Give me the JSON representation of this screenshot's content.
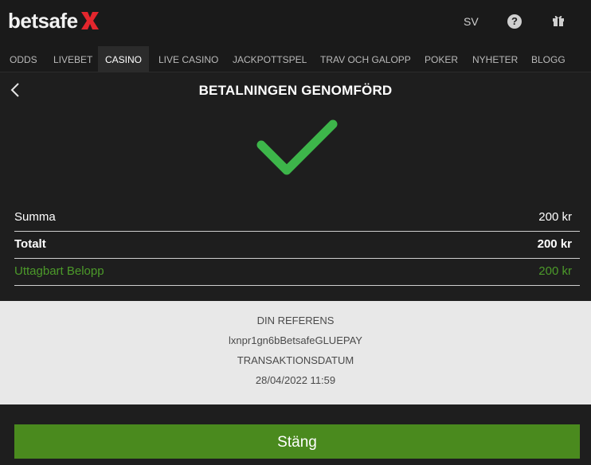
{
  "header": {
    "logo_text": "betsafe",
    "language": "SV",
    "help_glyph": "?",
    "icons": [
      "help-icon",
      "gift-icon"
    ]
  },
  "nav": {
    "items": [
      {
        "label": "ODDS"
      },
      {
        "label": "LIVEBET"
      },
      {
        "label": "CASINO",
        "active": true
      },
      {
        "label": "LIVE CASINO"
      },
      {
        "label": "JACKPOTTSPEL"
      },
      {
        "label": "TRAV OCH GALOPP"
      },
      {
        "label": "POKER"
      },
      {
        "label": "NYHETER"
      },
      {
        "label": "BLOGG"
      }
    ]
  },
  "modal": {
    "title": "BETALNINGEN GENOMFÖRD",
    "rows": [
      {
        "label": "Summa",
        "value": "200 kr"
      },
      {
        "label": "Totalt",
        "value": "200 kr"
      },
      {
        "label": "Uttagbart Belopp",
        "value": "200 kr"
      }
    ],
    "reference_label": "DIN REFERENS",
    "reference_value": "lxnpr1gn6bBetsafeGLUEPAY",
    "date_label": "TRANSAKTIONSDATUM",
    "date_value": "28/04/2022 11:59",
    "close_label": "Stäng"
  },
  "colors": {
    "background": "#1e1e1e",
    "accent_green": "#4a8a1e",
    "check_green": "#3db54a",
    "logo_red": "#e3262d",
    "reference_panel": "#e8e8e8"
  }
}
